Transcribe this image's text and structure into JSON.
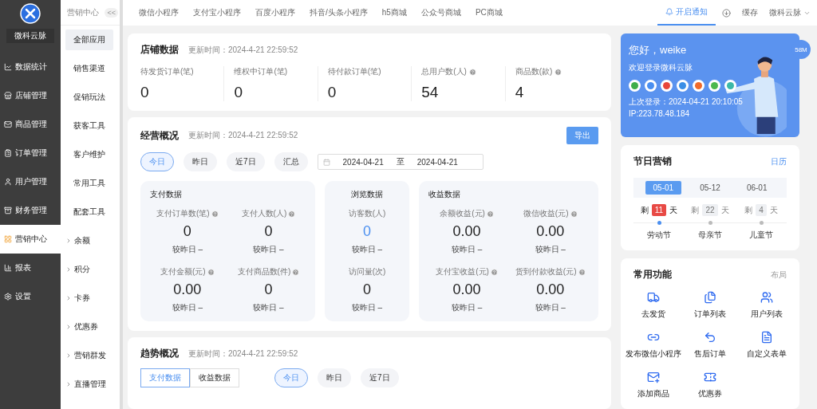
{
  "brand": {
    "name": "微科云脉"
  },
  "nav": [
    {
      "label": "数据统计",
      "selected": false
    },
    {
      "label": "店铺管理",
      "selected": false
    },
    {
      "label": "商品管理",
      "selected": false
    },
    {
      "label": "订单管理",
      "selected": false
    },
    {
      "label": "用户管理",
      "selected": false
    },
    {
      "label": "财务管理",
      "selected": false
    },
    {
      "label": "营销中心",
      "selected": true
    },
    {
      "label": "报表",
      "selected": false
    },
    {
      "label": "设置",
      "selected": false
    }
  ],
  "subnav": {
    "title": "营销中心",
    "collapse": "<<",
    "items": [
      {
        "label": "全部应用",
        "kind": "link",
        "selected": true
      },
      {
        "label": "销售渠道",
        "kind": "link",
        "selected": false
      },
      {
        "label": "促销玩法",
        "kind": "link",
        "selected": false
      },
      {
        "label": "获客工具",
        "kind": "link",
        "selected": false
      },
      {
        "label": "客户维护",
        "kind": "link",
        "selected": false
      },
      {
        "label": "常用工具",
        "kind": "link",
        "selected": false
      },
      {
        "label": "配套工具",
        "kind": "link",
        "selected": false
      },
      {
        "label": "余额",
        "kind": "group",
        "selected": false
      },
      {
        "label": "积分",
        "kind": "group",
        "selected": false
      },
      {
        "label": "卡券",
        "kind": "group",
        "selected": false
      },
      {
        "label": "优惠券",
        "kind": "group",
        "selected": false
      },
      {
        "label": "营销群发",
        "kind": "group",
        "selected": false
      },
      {
        "label": "直播管理",
        "kind": "group",
        "selected": false
      }
    ]
  },
  "top_tabs": [
    "微信小程序",
    "支付宝小程序",
    "百度小程序",
    "抖音/头条小程序",
    "h5商城",
    "公众号商城",
    "PC商城"
  ],
  "top_right": {
    "notify": {
      "label": "开启通知",
      "selected": true
    },
    "cache": "缓存",
    "user": "微科云脉"
  },
  "store_data": {
    "title": "店铺数据",
    "updated": "更新时间：2024-4-21 22:59:52",
    "stats": [
      {
        "label": "待发货订单(笔)",
        "value": "0",
        "help": false
      },
      {
        "label": "维权中订单(笔)",
        "value": "0",
        "help": false
      },
      {
        "label": "待付款订单(笔)",
        "value": "0",
        "help": false
      },
      {
        "label": "总用户数(人)",
        "value": "54",
        "help": true
      },
      {
        "label": "商品数(款)",
        "value": "4",
        "help": true
      }
    ]
  },
  "overview": {
    "title": "经营概况",
    "updated": "更新时间：2024-4-21 22:59:52",
    "export": "导出",
    "ranges": [
      {
        "label": "今日",
        "selected": true
      },
      {
        "label": "昨日",
        "selected": false
      },
      {
        "label": "近7日",
        "selected": false
      },
      {
        "label": "汇总",
        "selected": false
      }
    ],
    "date_from": "2024-04-21",
    "date_sep": "至",
    "date_to": "2024-04-21",
    "panels": [
      {
        "title": "支付数据",
        "kind": "grid",
        "metrics": [
          {
            "label": "支付订单数(笔)",
            "help": true,
            "value": "0",
            "accent": false,
            "compare": "较昨日 –"
          },
          {
            "label": "支付人数(人)",
            "help": true,
            "value": "0",
            "accent": false,
            "compare": "较昨日 –"
          },
          {
            "label": "支付金额(元)",
            "help": true,
            "value": "0.00",
            "accent": false,
            "compare": "较昨日 –"
          },
          {
            "label": "支付商品数(件)",
            "help": true,
            "value": "0",
            "accent": false,
            "compare": "较昨日 –"
          }
        ]
      },
      {
        "title": "浏览数据",
        "kind": "single",
        "metrics": [
          {
            "label": "访客数(人)",
            "help": false,
            "value": "0",
            "accent": true,
            "compare": "较昨日 –"
          },
          {
            "label": "访问量(次)",
            "help": false,
            "value": "0",
            "accent": false,
            "compare": "较昨日 –"
          }
        ]
      },
      {
        "title": "收益数据",
        "kind": "grid",
        "metrics": [
          {
            "label": "余额收益(元)",
            "help": true,
            "value": "0.00",
            "accent": false,
            "compare": "较昨日 –"
          },
          {
            "label": "微信收益(元)",
            "help": true,
            "value": "0.00",
            "accent": false,
            "compare": "较昨日 –"
          },
          {
            "label": "支付宝收益(元)",
            "help": true,
            "value": "0.00",
            "accent": false,
            "compare": "较昨日 –"
          },
          {
            "label": "货到付款收益(元)",
            "help": true,
            "value": "0.00",
            "accent": false,
            "compare": "较昨日 –"
          }
        ]
      }
    ]
  },
  "trend": {
    "title": "趋势概况",
    "updated": "更新时间：2024-4-21 22:59:52",
    "data_tabs": [
      {
        "label": "支付数据",
        "selected": true
      },
      {
        "label": "收益数据",
        "selected": false
      }
    ],
    "ranges": [
      {
        "label": "今日",
        "selected": true
      },
      {
        "label": "昨日",
        "selected": false
      },
      {
        "label": "近7日",
        "selected": false
      }
    ]
  },
  "welcome": {
    "greeting": "您好，weike",
    "subtitle": "欢迎登录微科云脉",
    "last_login": "上次登录：2024-04-21 20:10:05",
    "ip": "IP:223.78.48.184",
    "channels": [
      {
        "color": "#3fae49"
      },
      {
        "color": "#4a8ff0"
      },
      {
        "color": "#e8463a"
      },
      {
        "color": "#3a8ee6"
      },
      {
        "color": "#f06a2a"
      },
      {
        "color": "#4cb84e"
      },
      {
        "color": "#3cb8a8"
      }
    ]
  },
  "memory_badge": "58M",
  "festival": {
    "title": "节日营销",
    "link": "日历",
    "items": [
      {
        "date": "05-01",
        "selected": true,
        "prefix": "剩",
        "days": "11",
        "suffix": "天",
        "name": "劳动节"
      },
      {
        "date": "05-12",
        "selected": false,
        "prefix": "剩",
        "days": "22",
        "suffix": "天",
        "name": "母亲节"
      },
      {
        "date": "06-01",
        "selected": false,
        "prefix": "剩",
        "days": "4",
        "suffix": "天",
        "name": "儿童节"
      }
    ]
  },
  "shortcuts": {
    "title": "常用功能",
    "link": "布局",
    "items": [
      {
        "label": "去发货"
      },
      {
        "label": "订单列表"
      },
      {
        "label": "用户列表"
      },
      {
        "label": "发布微信小程序"
      },
      {
        "label": "售后订单"
      },
      {
        "label": "自定义表单"
      },
      {
        "label": "添加商品"
      },
      {
        "label": "优惠券"
      }
    ]
  }
}
